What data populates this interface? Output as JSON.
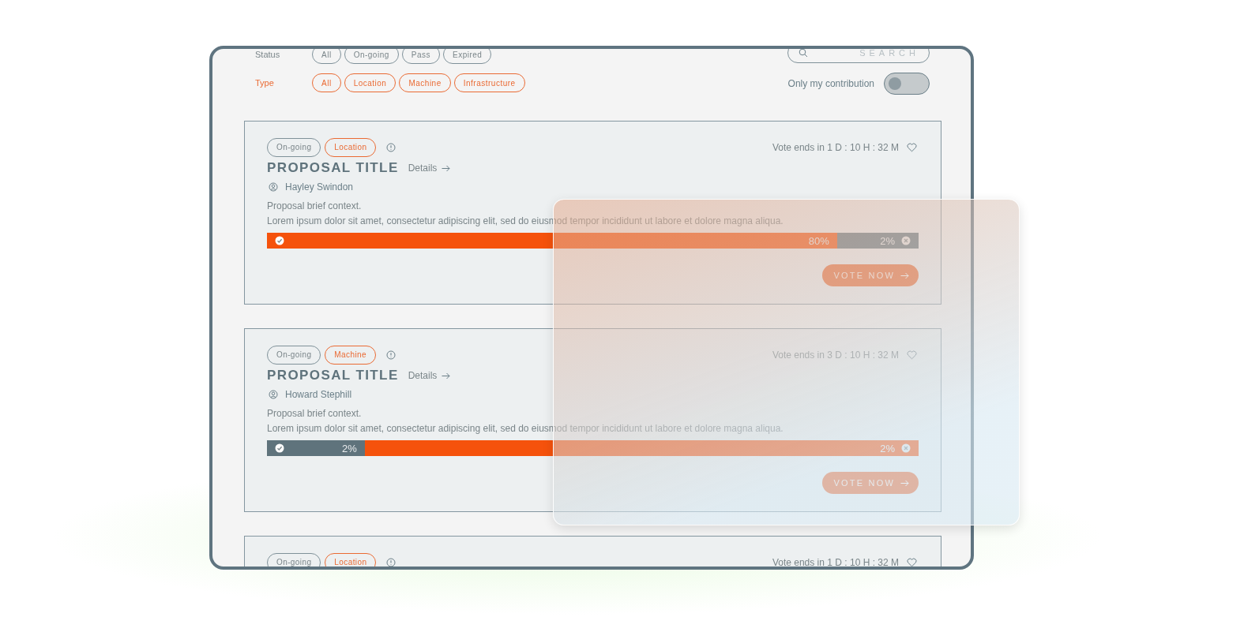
{
  "filters": [
    {
      "label": "Status",
      "active": false,
      "chips": [
        "All",
        "On-going",
        "Pass",
        "Expired"
      ]
    },
    {
      "label": "Type",
      "active": true,
      "chips": [
        "All",
        "Location",
        "Machine",
        "Infrastructure"
      ]
    }
  ],
  "search": {
    "placeholder": "SEARCH"
  },
  "contribution_toggle": {
    "label": "Only my contribution",
    "on": false
  },
  "proposals": [
    {
      "status": "On-going",
      "type": "Location",
      "title": "PROPOSAL TITLE",
      "details": "Details",
      "author": "Hayley Swindon",
      "vote_ends": "Vote ends in 1 D : 10 H : 32 M",
      "context": "Proposal brief context.",
      "description": "Lorem ipsum dolor sit amet, consectetur adipiscing elit, sed do eiusmod tempor incididunt ut labore et dolore magna aliqua.",
      "level": 0.875,
      "yes_label": "80%",
      "no_label": "2%",
      "button": "VOTE NOW"
    },
    {
      "status": "On-going",
      "type": "Machine",
      "title": "PROPOSAL TITLE",
      "details": "Details",
      "author": "Howard Stephill",
      "vote_ends": "Vote ends in 3 D : 10 H : 32 M",
      "context": "Proposal brief context.",
      "description": "Lorem ipsum dolor sit amet, consectetur adipiscing elit, sed do eiusmod tempor incididunt ut labore et dolore magna aliqua.",
      "level": 0.15,
      "yes_label": "2%",
      "no_label": "2%",
      "button": "VOTE NOW"
    },
    {
      "status": "On-going",
      "type": "Location",
      "vote_ends": "Vote ends in 1 D : 10 H : 32 M"
    }
  ]
}
